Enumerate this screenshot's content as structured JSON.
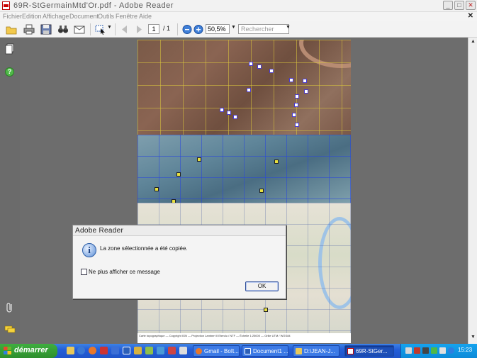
{
  "window": {
    "title": "69R-StGermainMtd'Or.pdf - Adobe Reader",
    "buttons": {
      "minimize": "_",
      "maximize": "□",
      "close": "✕"
    }
  },
  "menu": {
    "items": [
      "Fichier",
      "Edition",
      "Affichage",
      "Document",
      "Outils",
      "Fenêtre",
      "Aide"
    ],
    "close_doc": "✕"
  },
  "toolbar": {
    "page_current": "1",
    "page_total": "/ 1",
    "zoom": "50,5%",
    "search_placeholder": "Rechercher"
  },
  "map": {
    "footer": "Carte topographique — Copyright IGN — Projection Lambert II Etendu / NTF — Échelle 1:25000 — Grille UTM / WGS84"
  },
  "dialog": {
    "title": "Adobe Reader",
    "message": "La zone sélectionnée a été copiée.",
    "checkbox_label": "Ne plus afficher ce message",
    "ok_label": "OK"
  },
  "taskbar": {
    "start_label": "démarrer",
    "tasks": [
      {
        "label": "Gmail - Boît..."
      },
      {
        "label": "Document1 ..."
      },
      {
        "label": "D:\\JEAN-J..."
      },
      {
        "label": "69R-StGer..."
      }
    ],
    "clock": "15:23"
  },
  "colors": {
    "titlebar_text": "#5a5a5a",
    "taskbar_blue": "#245ed8",
    "start_green": "#2d8f2d",
    "tray_blue": "#0c8ad8",
    "dialog_ok_border": "#2f4f9a"
  }
}
